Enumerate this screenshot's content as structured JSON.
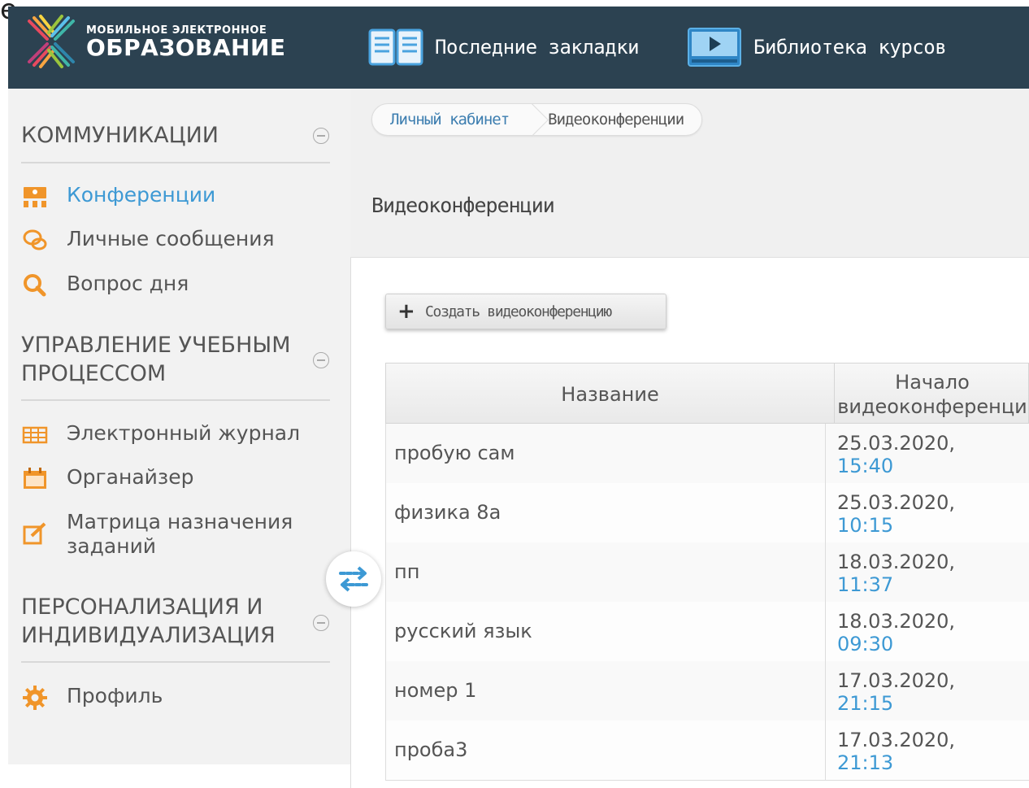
{
  "stray_char": "е",
  "header": {
    "logo_top": "МОБИЛЬНОЕ ЭЛЕКТРОННОЕ",
    "logo_bottom": "ОБРАЗОВАНИЕ",
    "bookmarks_label": "Последние закладки",
    "library_label": "Библиотека курсов"
  },
  "sidebar": {
    "sections": [
      {
        "title_lines": [
          "КОММУНИКАЦИИ"
        ],
        "items": [
          {
            "label": "Конференции",
            "icon": "conference-icon",
            "active": true
          },
          {
            "label": "Личные сообщения",
            "icon": "chat-icon",
            "active": false
          },
          {
            "label": "Вопрос дня",
            "icon": "magnifier-icon",
            "active": false
          }
        ]
      },
      {
        "title_lines": [
          "УПРАВЛЕНИЕ УЧЕБНЫМ",
          "ПРОЦЕССОМ"
        ],
        "items": [
          {
            "label": "Электронный журнал",
            "icon": "journal-grid-icon",
            "active": false
          },
          {
            "label": "Органайзер",
            "icon": "calendar-icon",
            "active": false
          },
          {
            "label_lines": [
              "Матрица назначения",
              "заданий"
            ],
            "icon": "edit-icon",
            "active": false
          }
        ]
      },
      {
        "title_lines": [
          "ПЕРСОНАЛИЗАЦИЯ И",
          "ИНДИВИДУАЛИЗАЦИЯ"
        ],
        "items": [
          {
            "label": "Профиль",
            "icon": "gear-icon",
            "active": false
          }
        ]
      }
    ]
  },
  "breadcrumb": {
    "home": "Личный кабинет",
    "current": "Видеоконференции"
  },
  "page_title": "Видеоконференции",
  "create_button": "Создать видеоконференцию",
  "table": {
    "headers": {
      "name": "Название",
      "start_line1": "Начало",
      "start_line2": "видеоконференци"
    },
    "rows": [
      {
        "name": "пробую сам",
        "date": "25.03.2020,",
        "time": "15:40"
      },
      {
        "name": "физика 8а",
        "date": "25.03.2020,",
        "time": "10:15"
      },
      {
        "name": "пп",
        "date": "18.03.2020,",
        "time": "11:37"
      },
      {
        "name": "русский язык",
        "date": "18.03.2020,",
        "time": "09:30"
      },
      {
        "name": "номер 1",
        "date": "17.03.2020,",
        "time": "21:15"
      },
      {
        "name": "проба3",
        "date": "17.03.2020,",
        "time": "21:13"
      }
    ]
  },
  "colors": {
    "header_bg": "#2c4251",
    "accent_blue": "#3d99d4",
    "icon_orange": "#f0952a",
    "sidebar_bg": "#f2f2f2"
  }
}
